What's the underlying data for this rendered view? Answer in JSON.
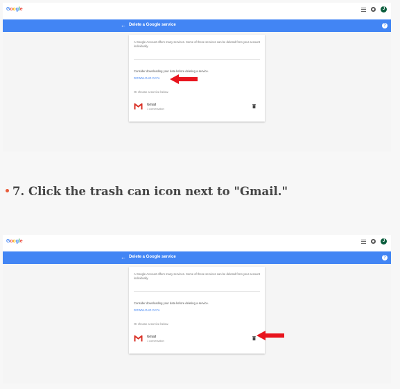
{
  "shot1": {
    "logo": [
      "G",
      "o",
      "o",
      "g",
      "l",
      "e"
    ],
    "avatar_letter": "J",
    "bar_title": "Delete a Google service",
    "intro": "A Google Account offers many services. Some of these services can be deleted from your account individually.",
    "consider": "Consider downloading your data before deleting a service.",
    "download": "DOWNLOAD DATA",
    "or_choose": "Or choose a service below.",
    "service_name": "Gmail",
    "service_sub": "1 conversation"
  },
  "caption": "7. Click the trash can icon next to \"Gmail.\"",
  "shot2": {
    "logo": [
      "G",
      "o",
      "o",
      "g",
      "l",
      "e"
    ],
    "avatar_letter": "J",
    "bar_title": "Delete a Google service",
    "intro": "A Google Account offers many services. Some of these services can be deleted from your account individually.",
    "consider": "Consider downloading your data before deleting a service.",
    "download": "DOWNLOAD DATA",
    "or_choose": "Or choose a service below.",
    "service_name": "Gmail",
    "service_sub": "1 conversation"
  },
  "colors": {
    "accent_blue": "#4285f4",
    "arrow_red": "#e8141d",
    "bullet": "#e85b3a"
  },
  "icons": [
    "apps-icon",
    "gear-icon",
    "back-arrow-icon",
    "help-icon",
    "gmail-icon",
    "trash-icon",
    "red-arrow-icon"
  ]
}
